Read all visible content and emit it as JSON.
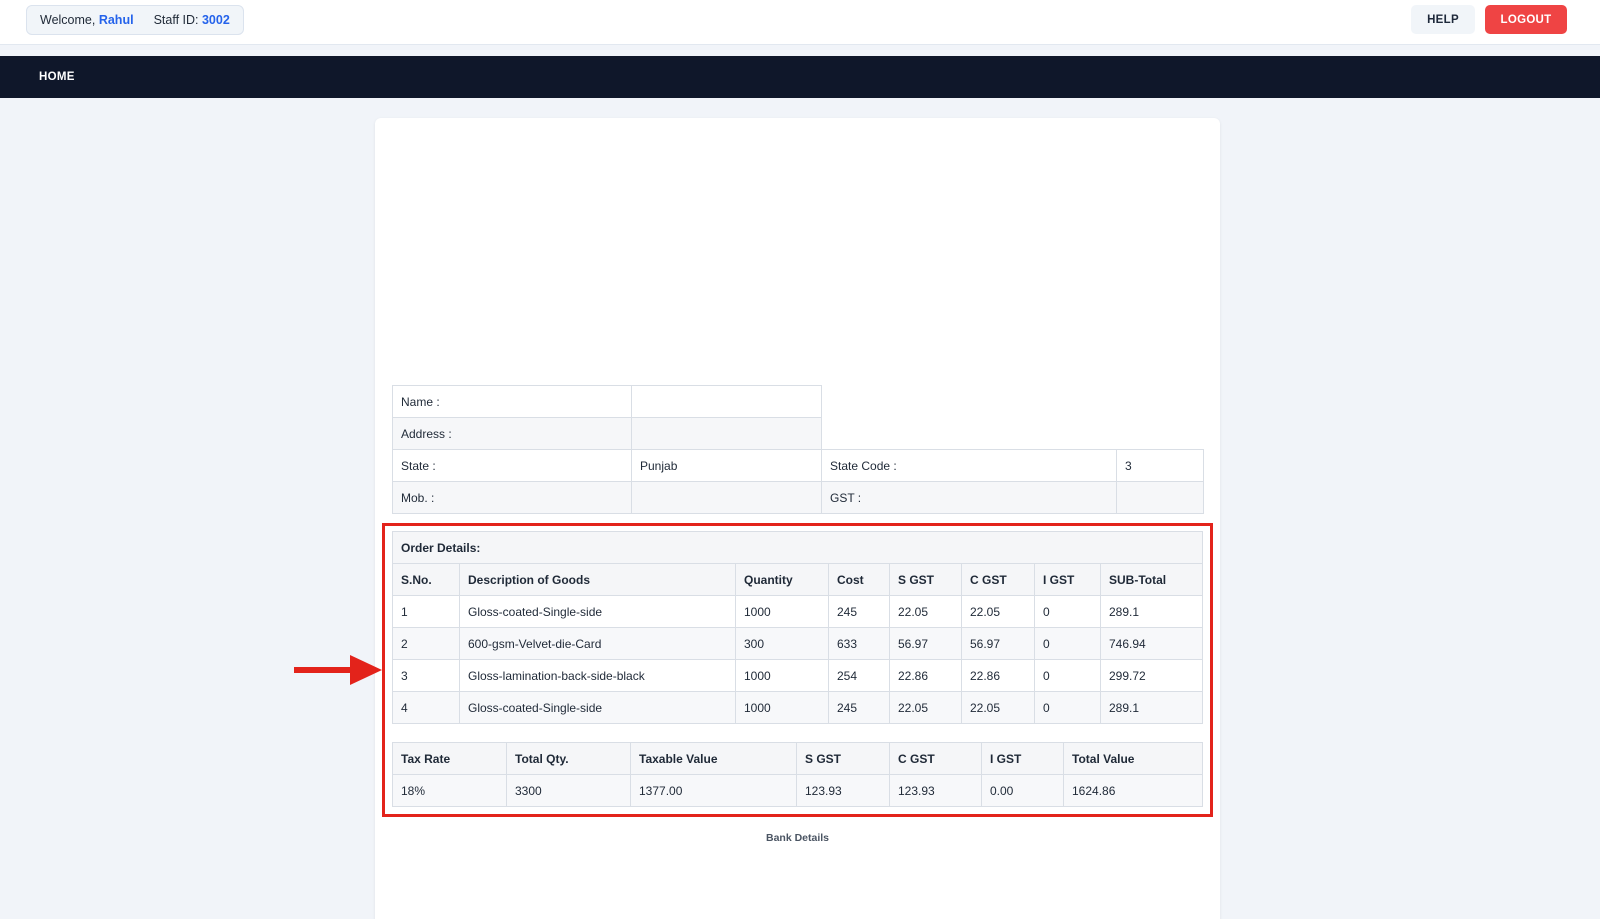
{
  "header": {
    "welcome_prefix": "Welcome,",
    "user_name": "Rahul",
    "staff_label": "Staff ID:",
    "staff_id": "3002",
    "help_label": "HELP",
    "logout_label": "LOGOUT"
  },
  "nav": {
    "home_label": "HOME"
  },
  "customer": {
    "name_label": "Name :",
    "name_value": "",
    "address_label": "Address :",
    "address_value": "",
    "state_label": "State :",
    "state_value": "Punjab",
    "state_code_label": "State Code :",
    "state_code_value": "3",
    "mob_label": "Mob. :",
    "mob_value": "",
    "gst_label": "GST :",
    "gst_value": ""
  },
  "order": {
    "title": "Order Details:",
    "columns": [
      "S.No.",
      "Description of Goods",
      "Quantity",
      "Cost",
      "S GST",
      "C GST",
      "I GST",
      "SUB-Total"
    ],
    "rows": [
      [
        "1",
        "Gloss-coated-Single-side",
        "1000",
        "245",
        "22.05",
        "22.05",
        "0",
        "289.1"
      ],
      [
        "2",
        "600-gsm-Velvet-die-Card",
        "300",
        "633",
        "56.97",
        "56.97",
        "0",
        "746.94"
      ],
      [
        "3",
        "Gloss-lamination-back-side-black",
        "1000",
        "254",
        "22.86",
        "22.86",
        "0",
        "299.72"
      ],
      [
        "4",
        "Gloss-coated-Single-side",
        "1000",
        "245",
        "22.05",
        "22.05",
        "0",
        "289.1"
      ]
    ]
  },
  "summary": {
    "columns": [
      "Tax Rate",
      "Total Qty.",
      "Taxable Value",
      "S GST",
      "C GST",
      "I GST",
      "Total Value"
    ],
    "values": [
      "18%",
      "3300",
      "1377.00",
      "123.93",
      "123.93",
      "0.00",
      "1624.86"
    ]
  },
  "bank": {
    "title": "Bank Details"
  },
  "colors": {
    "accent": "#2563eb",
    "logout": "#ef4444",
    "navbar": "#0f172a",
    "annotation": "#e3231b"
  },
  "annotation": {
    "arrow_icon": "right-arrow-icon"
  }
}
